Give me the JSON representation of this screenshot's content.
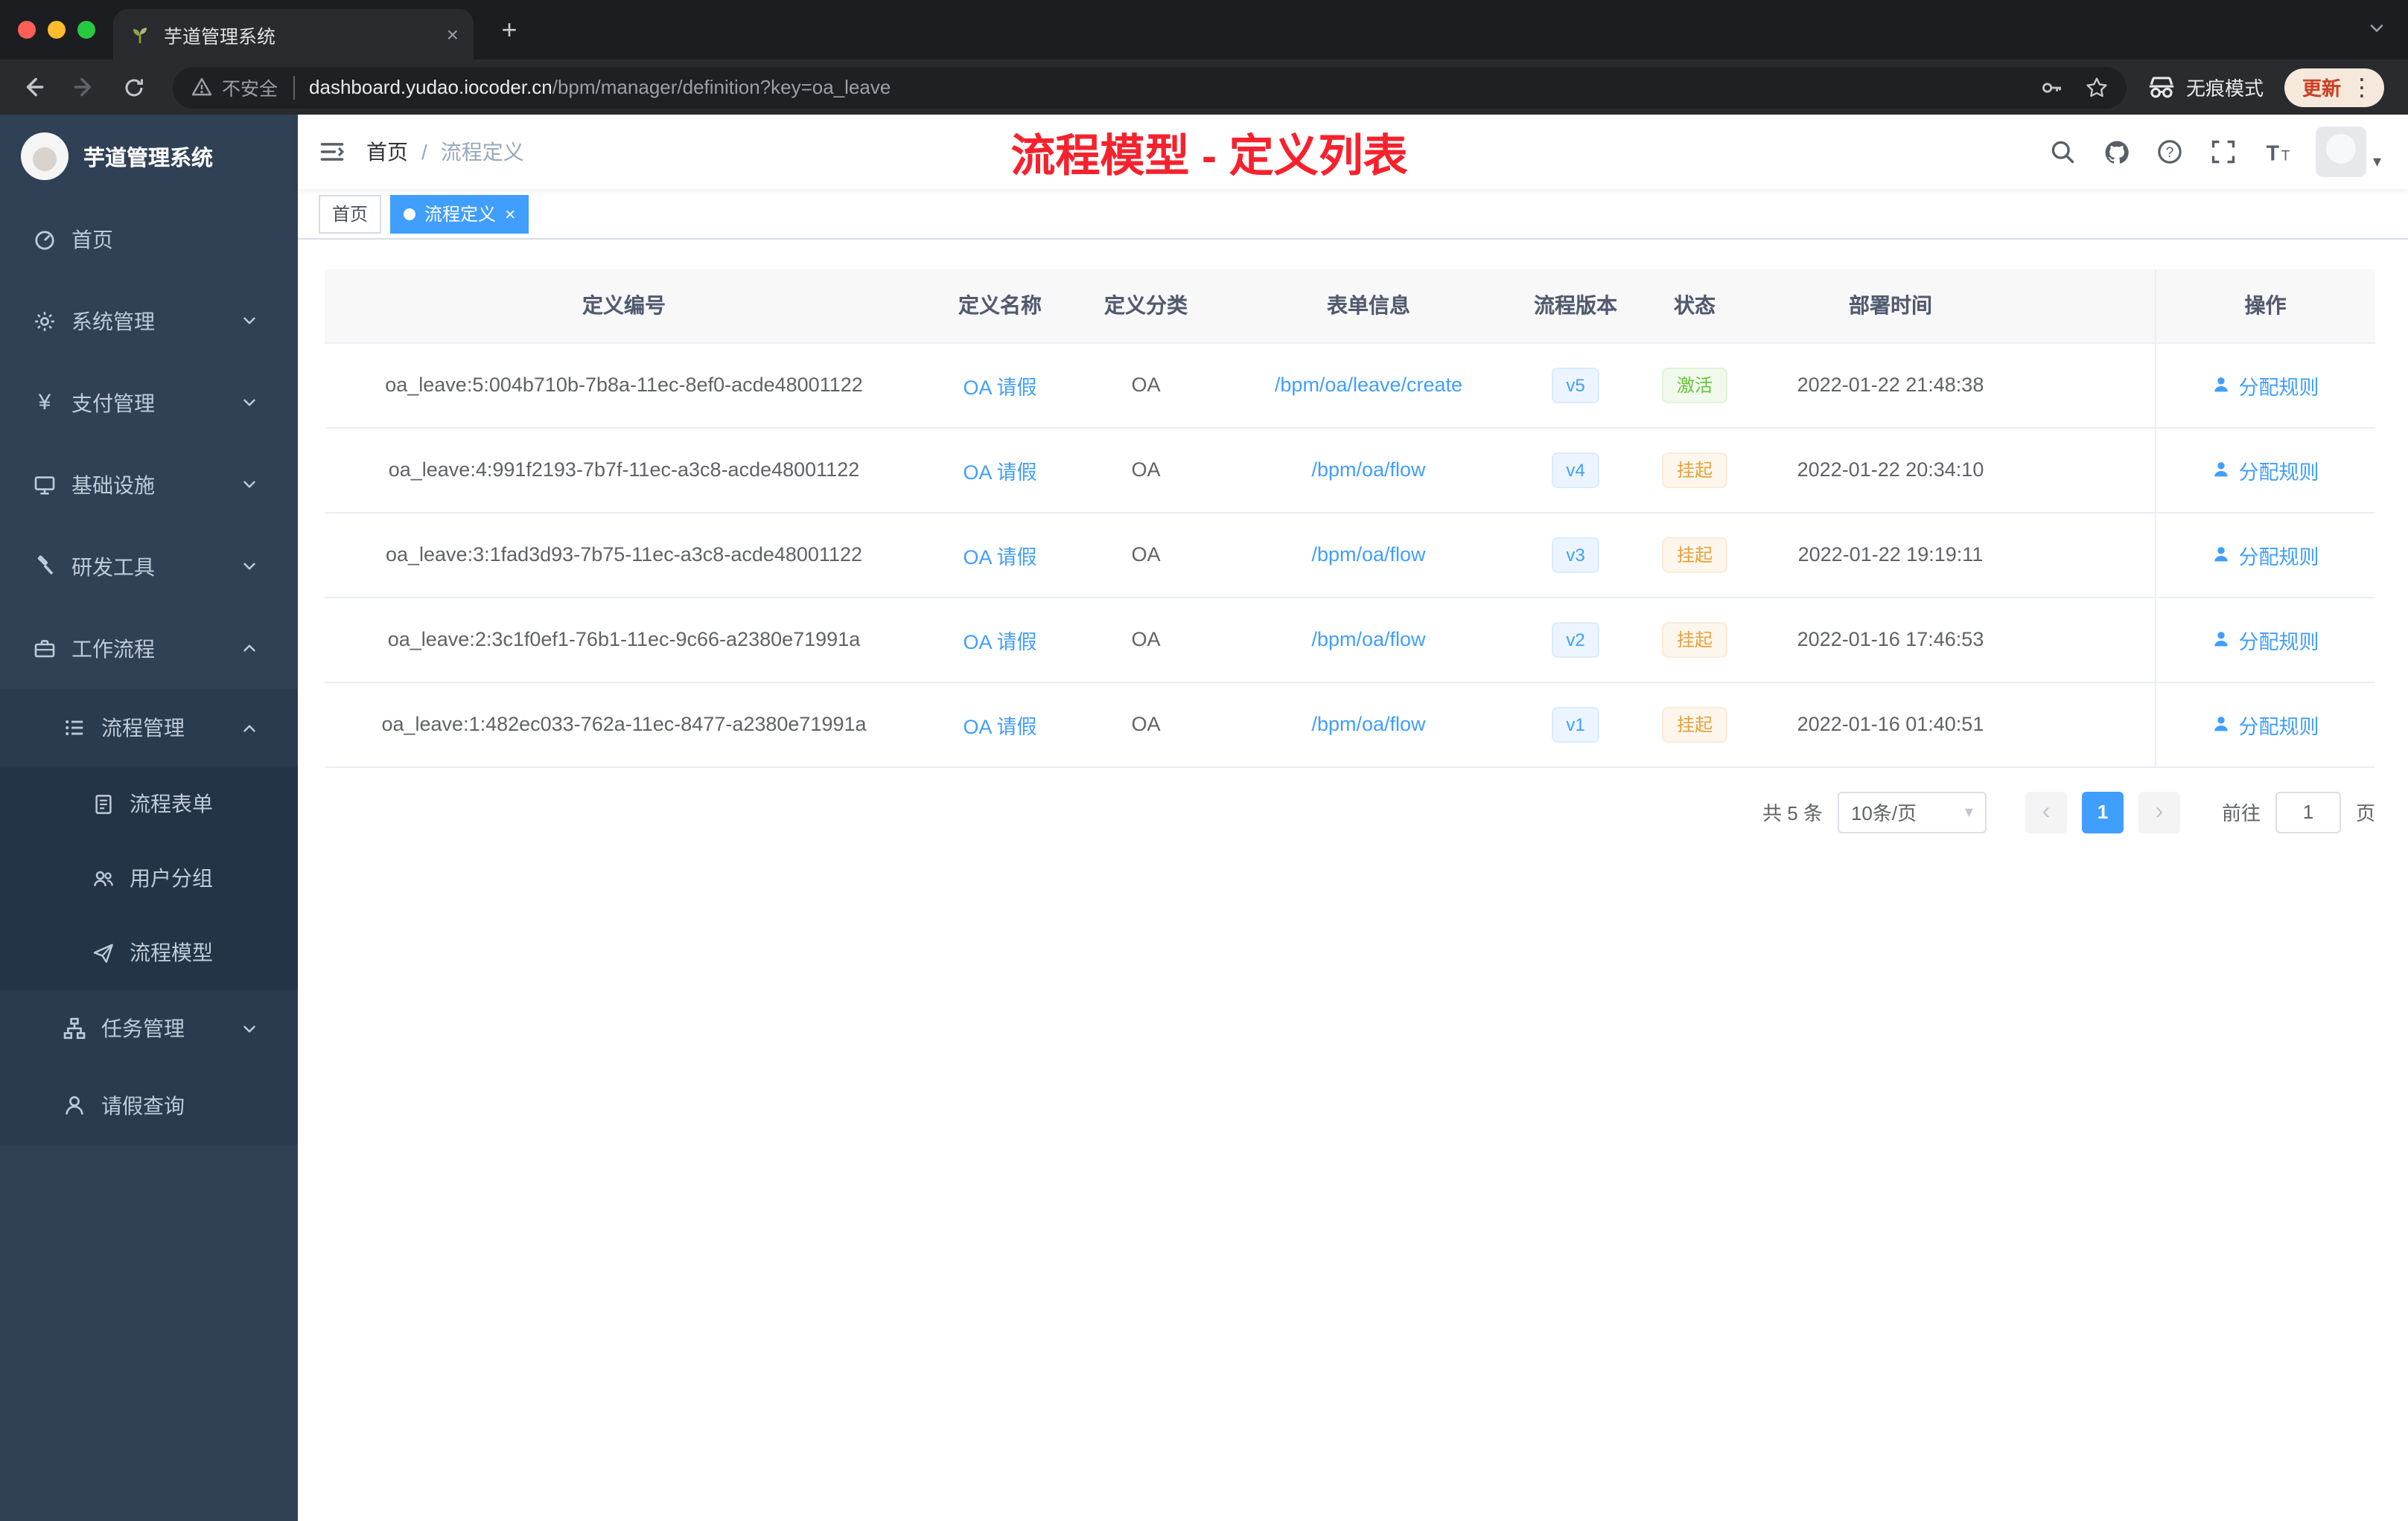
{
  "colors": {
    "accent": "#409eff",
    "success": "#67c23a",
    "warning": "#e6a23c",
    "annotation_red": "#f5222d",
    "sidebar_bg": "#304156"
  },
  "browser": {
    "tab_title": "芋道管理系统",
    "security_label": "不安全",
    "url_host": "dashboard.yudao.iocoder.cn",
    "url_path": "/bpm/manager/definition?key=oa_leave",
    "incognito_label": "无痕模式",
    "update_label": "更新"
  },
  "sidebar": {
    "logo_title": "芋道管理系统",
    "items": [
      {
        "label": "首页",
        "icon": "home-icon",
        "level": 0,
        "expandable": false
      },
      {
        "label": "系统管理",
        "icon": "gear-icon",
        "level": 0,
        "expandable": true,
        "expanded": false
      },
      {
        "label": "支付管理",
        "icon": "yen-icon",
        "level": 0,
        "expandable": true,
        "expanded": false
      },
      {
        "label": "基础设施",
        "icon": "infrastructure-icon",
        "level": 0,
        "expandable": true,
        "expanded": false
      },
      {
        "label": "研发工具",
        "icon": "dev-tools-icon",
        "level": 0,
        "expandable": true,
        "expanded": false
      },
      {
        "label": "工作流程",
        "icon": "workflow-icon",
        "level": 0,
        "expandable": true,
        "expanded": true
      },
      {
        "label": "流程管理",
        "icon": "process-management-icon",
        "level": 1,
        "expandable": true,
        "expanded": true
      },
      {
        "label": "流程表单",
        "icon": "process-form-icon",
        "level": 2,
        "expandable": false
      },
      {
        "label": "用户分组",
        "icon": "user-group-icon",
        "level": 2,
        "expandable": false
      },
      {
        "label": "流程模型",
        "icon": "process-model-icon",
        "level": 2,
        "expandable": false
      },
      {
        "label": "任务管理",
        "icon": "task-management-icon",
        "level": 1,
        "expandable": true,
        "expanded": false
      },
      {
        "label": "请假查询",
        "icon": "leave-query-icon",
        "level": 1,
        "expandable": false
      }
    ]
  },
  "navbar": {
    "breadcrumb": {
      "home": "首页",
      "separator": "/",
      "current": "流程定义"
    },
    "annotation": "流程模型 - 定义列表"
  },
  "tags_view": {
    "tags": [
      {
        "label": "首页",
        "active": false
      },
      {
        "label": "流程定义",
        "active": true,
        "closable": true
      }
    ]
  },
  "table": {
    "columns": [
      "定义编号",
      "定义名称",
      "定义分类",
      "表单信息",
      "流程版本",
      "状态",
      "部署时间",
      "操作"
    ],
    "rows": [
      {
        "id": "oa_leave:5:004b710b-7b8a-11ec-8ef0-acde48001122",
        "name": "OA 请假",
        "category": "OA",
        "form": "/bpm/oa/leave/create",
        "version": "v5",
        "status": "激活",
        "status_type": "success",
        "deploy_time": "2022-01-22 21:48:38",
        "action": "分配规则"
      },
      {
        "id": "oa_leave:4:991f2193-7b7f-11ec-a3c8-acde48001122",
        "name": "OA 请假",
        "category": "OA",
        "form": "/bpm/oa/flow",
        "version": "v4",
        "status": "挂起",
        "status_type": "warning",
        "deploy_time": "2022-01-22 20:34:10",
        "action": "分配规则"
      },
      {
        "id": "oa_leave:3:1fad3d93-7b75-11ec-a3c8-acde48001122",
        "name": "OA 请假",
        "category": "OA",
        "form": "/bpm/oa/flow",
        "version": "v3",
        "status": "挂起",
        "status_type": "warning",
        "deploy_time": "2022-01-22 19:19:11",
        "action": "分配规则"
      },
      {
        "id": "oa_leave:2:3c1f0ef1-76b1-11ec-9c66-a2380e71991a",
        "name": "OA 请假",
        "category": "OA",
        "form": "/bpm/oa/flow",
        "version": "v2",
        "status": "挂起",
        "status_type": "warning",
        "deploy_time": "2022-01-16 17:46:53",
        "action": "分配规则"
      },
      {
        "id": "oa_leave:1:482ec033-762a-11ec-8477-a2380e71991a",
        "name": "OA 请假",
        "category": "OA",
        "form": "/bpm/oa/flow",
        "version": "v1",
        "status": "挂起",
        "status_type": "warning",
        "deploy_time": "2022-01-16 01:40:51",
        "action": "分配规则"
      }
    ]
  },
  "pagination": {
    "total_label": "共 5 条",
    "page_size_label": "10条/页",
    "current_page": "1",
    "goto_label": "前往",
    "goto_value": "1",
    "page_unit_label": "页"
  }
}
